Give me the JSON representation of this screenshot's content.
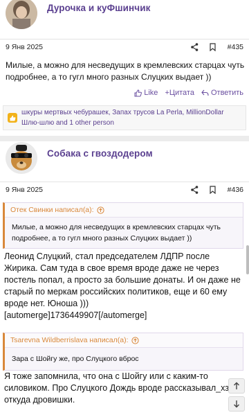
{
  "post1": {
    "author": "Дурочка и куФшинчик",
    "date": "9 Янв 2025",
    "number": "#435",
    "text": "Милые, а можно для несведущих в кремлевских старцах чуть подробнее, а то гугл много разных Слуцких выдает ))",
    "like_label": "Like",
    "quote_label": "+Цитата",
    "reply_label": "Ответить",
    "reactions": "шкуры мертвых чебурашек, Запах трусов La Perla, MillionDollar Шлю-шлю and 1 other person"
  },
  "post2": {
    "author": "Собака с гвоздодером",
    "date": "9 Янв 2025",
    "number": "#436",
    "quote1_author": "Отек Свинки написал(а):",
    "quote1_text": "Милые, а можно для несведущих в кремлевских старцах чуть подробнее, а то гугл много разных Слуцких выдает ))",
    "text1": "Леонид Слуцкий, стал председателем ЛДПР после Жирика. Сам туда в свое время вроде даже не через постель попал, а просто за большие донаты. И он даже не старый по меркам российских политиков, еще и 60 ему вроде нет. Юноша )))",
    "automerge": "[automerge]1736449907[/automerge]",
    "quote2_author": "Tsarevna Wildberrislava написал(а):",
    "quote2_text": "Зара с Шойгу же, про Слуцкого вброс",
    "text2": "Я тоже запомнила, что она с Шойгу или с каким-то силовиком. Про Слуцкого Дождь вроде рассказывал_хз, откуда дровишки."
  },
  "colors": {
    "accent": "#5a3f8f",
    "quote_accent": "#d9883a",
    "reaction": "#f2b21a"
  },
  "icons": [
    "share-icon",
    "bookmark-icon",
    "like-icon",
    "quote-icon",
    "reply-icon",
    "arrow-up-circle-icon",
    "scroll-up-icon",
    "scroll-down-icon"
  ]
}
